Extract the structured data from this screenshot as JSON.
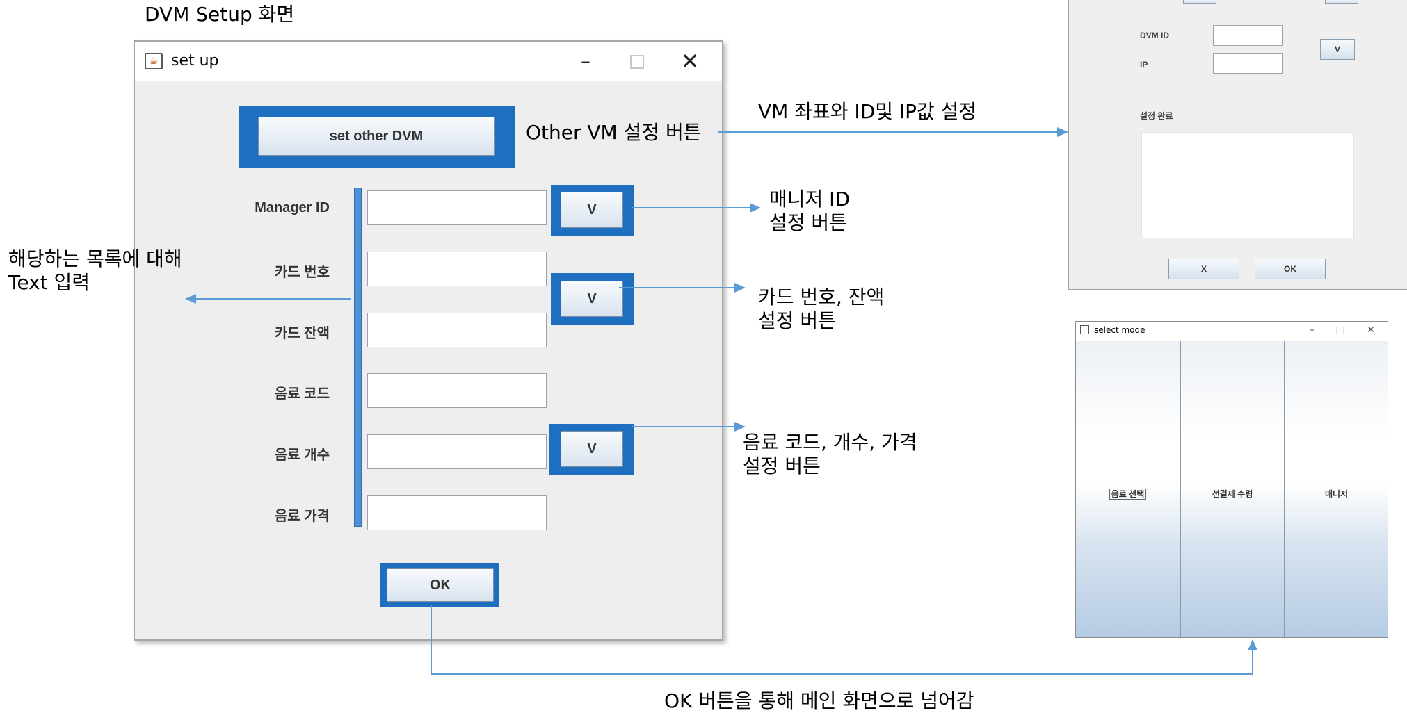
{
  "heading": "DVM Setup 화면",
  "setup_window": {
    "title": "set up",
    "set_other_dvm": "set other DVM",
    "fields": [
      {
        "label": "Manager ID",
        "value": ""
      },
      {
        "label": "카드 번호",
        "value": ""
      },
      {
        "label": "카드 잔액",
        "value": ""
      },
      {
        "label": "음료 코드",
        "value": ""
      },
      {
        "label": "음료 개수",
        "value": ""
      },
      {
        "label": "음료 가격",
        "value": ""
      }
    ],
    "v_label": "V",
    "ok_label": "OK"
  },
  "annotations": {
    "other_vm": "Other VM 설정 버튼",
    "vm_coord": "VM 좌표와 ID및 IP값 설정",
    "manager_id": "매니저 ID\n설정 버튼",
    "text_input": "해당하는 목록에 대해\nText 입력",
    "card": "카드 번호, 잔액\n설정 버튼",
    "drink": "음료 코드, 개수, 가격\n설정 버튼",
    "ok_next": "OK 버튼을 통해 메인 화면으로 넘어감"
  },
  "other_dvm_window": {
    "dvm_id_label": "DVM ID",
    "ip_label": "IP",
    "v_label": "V",
    "done_label": "설정 완료",
    "x_label": "X",
    "ok_label": "OK"
  },
  "select_mode_window": {
    "title": "select mode",
    "modes": [
      "음료 선택",
      "선결제 수령",
      "매니저"
    ]
  },
  "colors": {
    "highlight_border": "#1e6fc0",
    "arrow": "#5b9bd5",
    "field_bar": "#4d92d6"
  }
}
